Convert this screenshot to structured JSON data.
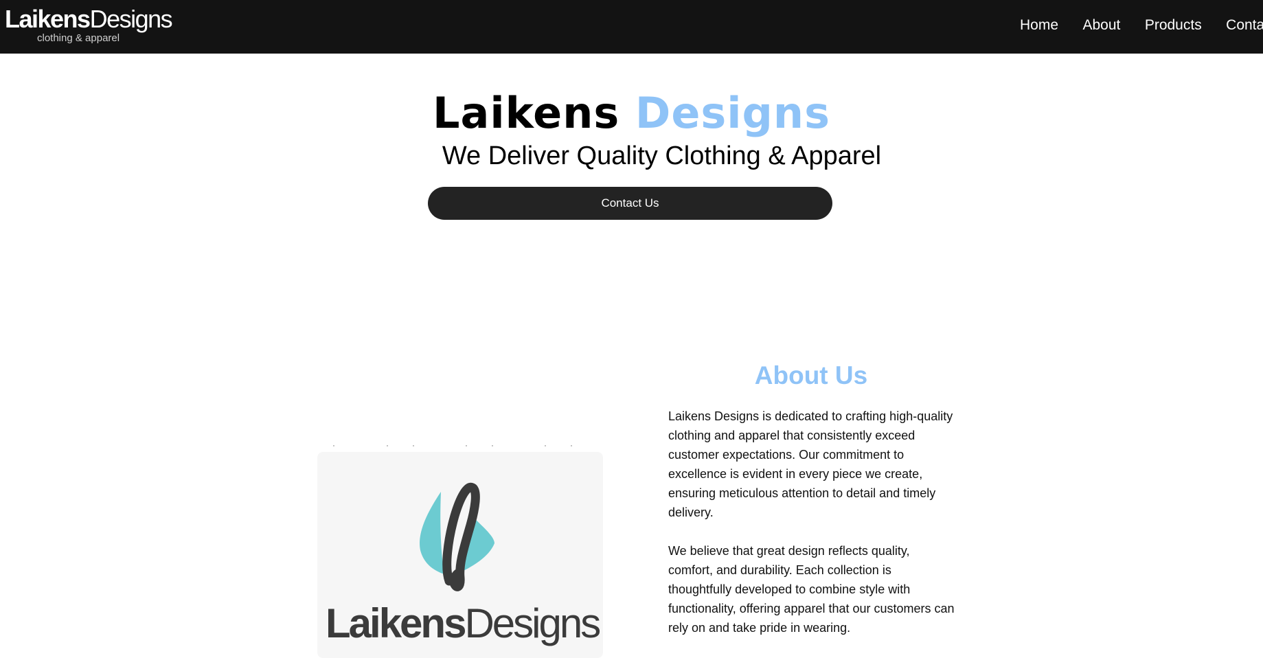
{
  "nav": {
    "brand": {
      "name_bold": "Laikens",
      "name_light": "Designs",
      "tagline": "clothing & apparel"
    },
    "links": [
      "Home",
      "About",
      "Products",
      "Contact"
    ]
  },
  "hero": {
    "title_dark": "Laikens",
    "title_accent": "Designs",
    "subtitle": "We Deliver Quality Clothing & Apparel",
    "cta_label": "Contact Us"
  },
  "about": {
    "title": "About Us",
    "paragraphs": [
      "Laikens Designs is dedicated to crafting high-quality clothing and apparel that consistently exceed customer expectations. Our commitment to excellence is evident in every piece we create, ensuring meticulous attention to detail and timely delivery.",
      "We believe that great design reflects quality, comfort, and durability. Each collection is thoughtfully developed to combine style with functionality, offering apparel that our customers can rely on and take pride in wearing."
    ],
    "image_logo": {
      "text_bold": "Laikens",
      "text_light": "Designs",
      "icon": "leaf-letter-l-icon"
    }
  },
  "colors": {
    "nav_bg": "#131313",
    "accent_blue": "#8fc3f7",
    "button_bg": "#232323",
    "logo_teal": "#6ccbd1",
    "logo_dark": "#3b3b3b"
  }
}
